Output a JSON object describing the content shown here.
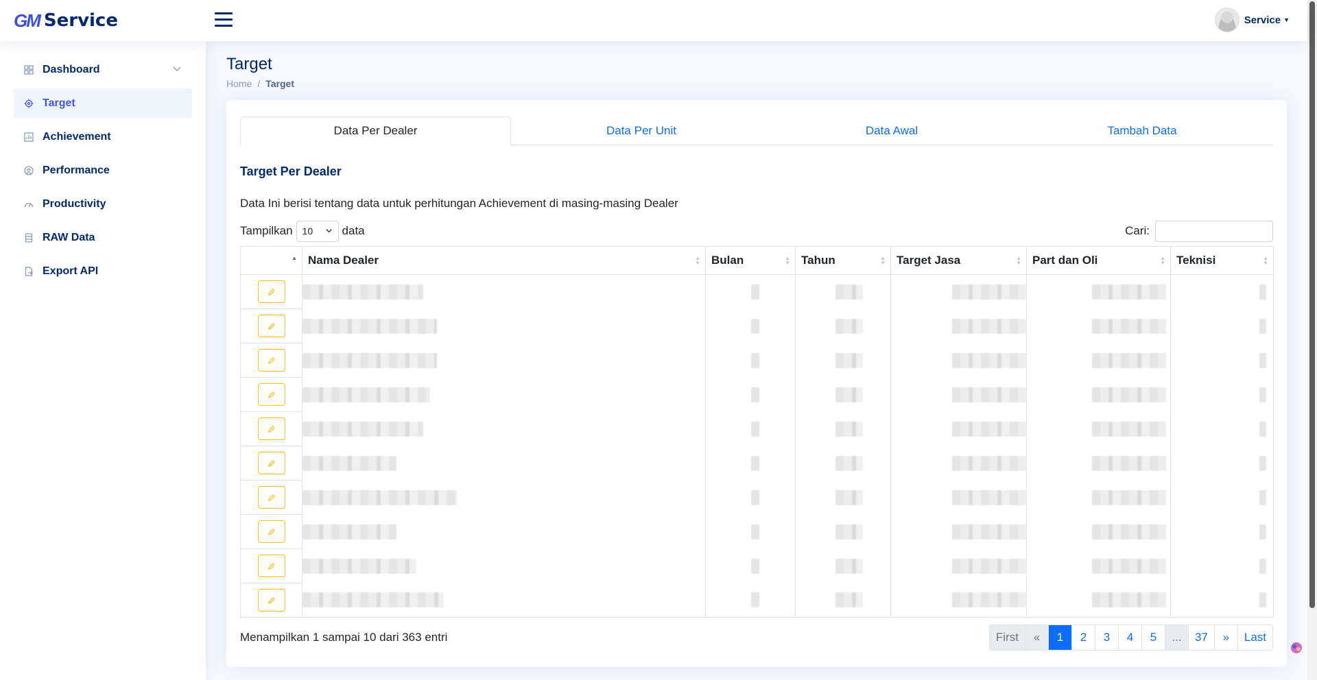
{
  "brand": {
    "mark": "GM",
    "name": "Service"
  },
  "user": {
    "name": "Service"
  },
  "sidebar": {
    "items": [
      {
        "label": "Dashboard",
        "icon": "grid-icon"
      },
      {
        "label": "Target",
        "icon": "target-icon"
      },
      {
        "label": "Achievement",
        "icon": "bar-chart-icon"
      },
      {
        "label": "Performance",
        "icon": "performance-icon"
      },
      {
        "label": "Productivity",
        "icon": "speedometer-icon"
      },
      {
        "label": "RAW Data",
        "icon": "database-icon"
      },
      {
        "label": "Export API",
        "icon": "file-export-icon"
      }
    ]
  },
  "page": {
    "title": "Target",
    "breadcrumb": {
      "home": "Home",
      "separator": "/",
      "current": "Target"
    }
  },
  "tabs": [
    "Data Per Dealer",
    "Data Per Unit",
    "Data Awal",
    "Tambah Data"
  ],
  "section": {
    "title": "Target Per Dealer",
    "description": "Data Ini berisi tentang data untuk perhitungan Achievement di masing-masing Dealer"
  },
  "table_controls": {
    "length_prefix": "Tampilkan",
    "length_value": "10",
    "length_suffix": "data",
    "search_label": "Cari:"
  },
  "table": {
    "columns": [
      "",
      "Nama Dealer",
      "Bulan",
      "Tahun",
      "Target Jasa",
      "Part dan Oli",
      "Teknisi"
    ],
    "row_count": 10
  },
  "footer": {
    "info": "Menampilkan 1 sampai 10 dari 363 entri",
    "pages": [
      "First",
      "«",
      "1",
      "2",
      "3",
      "4",
      "5",
      "...",
      "37",
      "»",
      "Last"
    ],
    "current_page": "1"
  },
  "colors": {
    "primary": "#4154f1",
    "link": "#0d6efd",
    "edit": "#ffc107",
    "navy": "#012970"
  }
}
